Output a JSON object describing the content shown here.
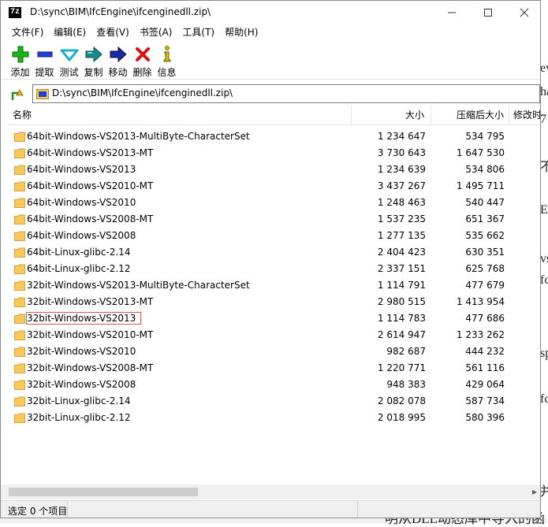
{
  "window": {
    "title": "D:\\sync\\BIM\\IfcEngine\\ifcenginedll.zip\\",
    "app_icon_text": "7z",
    "minimize": "—",
    "maximize": "☐",
    "close": "✕"
  },
  "menu": [
    "文件(F)",
    "编辑(E)",
    "查看(V)",
    "书签(A)",
    "工具(T)",
    "帮助(H)"
  ],
  "toolbar": [
    {
      "label": "添加",
      "icon": "add-icon",
      "color": "#18b418"
    },
    {
      "label": "提取",
      "icon": "extract-icon",
      "color": "#1f3fd8"
    },
    {
      "label": "测试",
      "icon": "test-icon",
      "color": "#1ab0c8"
    },
    {
      "label": "复制",
      "icon": "copy-icon",
      "color": "#1a8a8a"
    },
    {
      "label": "移动",
      "icon": "move-icon",
      "color": "#1a2a9a"
    },
    {
      "label": "删除",
      "icon": "delete-icon",
      "color": "#e01010"
    },
    {
      "label": "信息",
      "icon": "info-icon",
      "color": "#d8c000"
    }
  ],
  "address": {
    "path": "D:\\sync\\BIM\\IfcEngine\\ifcenginedll.zip\\"
  },
  "columns": {
    "name": "名称",
    "size": "大小",
    "packed": "压缩后大小",
    "modified": "修改时"
  },
  "rows": [
    {
      "name": "64bit-Windows-VS2013-MultiByte-CharacterSet",
      "size": "1 234 647",
      "packed": "534 795"
    },
    {
      "name": "64bit-Windows-VS2013-MT",
      "size": "3 730 643",
      "packed": "1 647 530"
    },
    {
      "name": "64bit-Windows-VS2013",
      "size": "1 234 639",
      "packed": "534 806"
    },
    {
      "name": "64bit-Windows-VS2010-MT",
      "size": "3 437 267",
      "packed": "1 495 711"
    },
    {
      "name": "64bit-Windows-VS2010",
      "size": "1 248 463",
      "packed": "540 447"
    },
    {
      "name": "64bit-Windows-VS2008-MT",
      "size": "1 537 235",
      "packed": "651 367"
    },
    {
      "name": "64bit-Windows-VS2008",
      "size": "1 277 135",
      "packed": "535 662"
    },
    {
      "name": "64bit-Linux-glibc-2.14",
      "size": "2 404 423",
      "packed": "630 351"
    },
    {
      "name": "64bit-Linux-glibc-2.12",
      "size": "2 337 151",
      "packed": "625 768"
    },
    {
      "name": "32bit-Windows-VS2013-MultiByte-CharacterSet",
      "size": "1 114 791",
      "packed": "477 679"
    },
    {
      "name": "32bit-Windows-VS2013-MT",
      "size": "2 980 515",
      "packed": "1 413 954"
    },
    {
      "name": "32bit-Windows-VS2013",
      "size": "1 114 783",
      "packed": "477 686",
      "focused": true
    },
    {
      "name": "32bit-Windows-VS2010-MT",
      "size": "2 614 947",
      "packed": "1 233 262"
    },
    {
      "name": "32bit-Windows-VS2010",
      "size": "982 687",
      "packed": "444 232"
    },
    {
      "name": "32bit-Windows-VS2008-MT",
      "size": "1 220 771",
      "packed": "561 116"
    },
    {
      "name": "32bit-Windows-VS2008",
      "size": "948 383",
      "packed": "429 064"
    },
    {
      "name": "32bit-Linux-glibc-2.14",
      "size": "2 082 078",
      "packed": "587 734"
    },
    {
      "name": "32bit-Linux-glibc-2.12",
      "size": "2 018 995",
      "packed": "580 396"
    }
  ],
  "status": {
    "text": "选定 0 个项目"
  },
  "background": {
    "fragments": [
      "ev",
      "ha",
      "7",
      "不",
      "E",
      "vs",
      "fc",
      "sp",
      "fc",
      "并"
    ],
    "bottom_text": "明从DLL动态库中导入的函"
  },
  "colors": {
    "folder": "#f7c95c",
    "focus_outline": "#d9534f"
  }
}
